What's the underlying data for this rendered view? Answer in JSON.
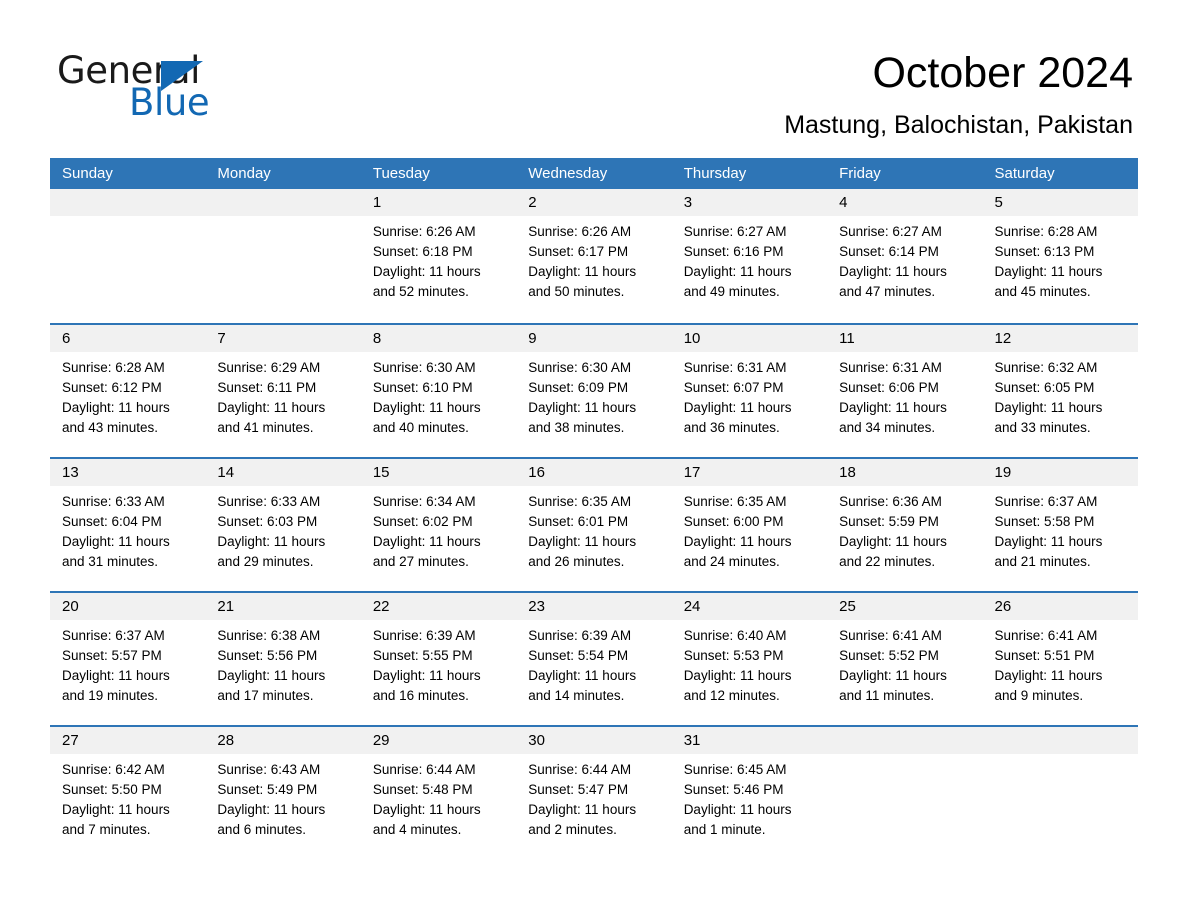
{
  "brand": {
    "word_one": "General",
    "word_two": "Blue",
    "triangle_icon": "triangle-icon",
    "accent_color": "#1268b3"
  },
  "header": {
    "title": "October 2024",
    "subtitle": "Mastung, Balochistan, Pakistan"
  },
  "theme": {
    "header_blue": "#2e75b6",
    "date_band_gray": "#f1f1f1",
    "text_black": "#000000"
  },
  "calendar": {
    "weekdays": [
      "Sunday",
      "Monday",
      "Tuesday",
      "Wednesday",
      "Thursday",
      "Friday",
      "Saturday"
    ],
    "weeks": [
      [
        {
          "day": "",
          "sunrise": "",
          "sunset": "",
          "daylight": "",
          "empty": true
        },
        {
          "day": "",
          "sunrise": "",
          "sunset": "",
          "daylight": "",
          "empty": true
        },
        {
          "day": "1",
          "sunrise": "Sunrise: 6:26 AM",
          "sunset": "Sunset: 6:18 PM",
          "daylight": "Daylight: 11 hours and 52 minutes."
        },
        {
          "day": "2",
          "sunrise": "Sunrise: 6:26 AM",
          "sunset": "Sunset: 6:17 PM",
          "daylight": "Daylight: 11 hours and 50 minutes."
        },
        {
          "day": "3",
          "sunrise": "Sunrise: 6:27 AM",
          "sunset": "Sunset: 6:16 PM",
          "daylight": "Daylight: 11 hours and 49 minutes."
        },
        {
          "day": "4",
          "sunrise": "Sunrise: 6:27 AM",
          "sunset": "Sunset: 6:14 PM",
          "daylight": "Daylight: 11 hours and 47 minutes."
        },
        {
          "day": "5",
          "sunrise": "Sunrise: 6:28 AM",
          "sunset": "Sunset: 6:13 PM",
          "daylight": "Daylight: 11 hours and 45 minutes."
        }
      ],
      [
        {
          "day": "6",
          "sunrise": "Sunrise: 6:28 AM",
          "sunset": "Sunset: 6:12 PM",
          "daylight": "Daylight: 11 hours and 43 minutes."
        },
        {
          "day": "7",
          "sunrise": "Sunrise: 6:29 AM",
          "sunset": "Sunset: 6:11 PM",
          "daylight": "Daylight: 11 hours and 41 minutes."
        },
        {
          "day": "8",
          "sunrise": "Sunrise: 6:30 AM",
          "sunset": "Sunset: 6:10 PM",
          "daylight": "Daylight: 11 hours and 40 minutes."
        },
        {
          "day": "9",
          "sunrise": "Sunrise: 6:30 AM",
          "sunset": "Sunset: 6:09 PM",
          "daylight": "Daylight: 11 hours and 38 minutes."
        },
        {
          "day": "10",
          "sunrise": "Sunrise: 6:31 AM",
          "sunset": "Sunset: 6:07 PM",
          "daylight": "Daylight: 11 hours and 36 minutes."
        },
        {
          "day": "11",
          "sunrise": "Sunrise: 6:31 AM",
          "sunset": "Sunset: 6:06 PM",
          "daylight": "Daylight: 11 hours and 34 minutes."
        },
        {
          "day": "12",
          "sunrise": "Sunrise: 6:32 AM",
          "sunset": "Sunset: 6:05 PM",
          "daylight": "Daylight: 11 hours and 33 minutes."
        }
      ],
      [
        {
          "day": "13",
          "sunrise": "Sunrise: 6:33 AM",
          "sunset": "Sunset: 6:04 PM",
          "daylight": "Daylight: 11 hours and 31 minutes."
        },
        {
          "day": "14",
          "sunrise": "Sunrise: 6:33 AM",
          "sunset": "Sunset: 6:03 PM",
          "daylight": "Daylight: 11 hours and 29 minutes."
        },
        {
          "day": "15",
          "sunrise": "Sunrise: 6:34 AM",
          "sunset": "Sunset: 6:02 PM",
          "daylight": "Daylight: 11 hours and 27 minutes."
        },
        {
          "day": "16",
          "sunrise": "Sunrise: 6:35 AM",
          "sunset": "Sunset: 6:01 PM",
          "daylight": "Daylight: 11 hours and 26 minutes."
        },
        {
          "day": "17",
          "sunrise": "Sunrise: 6:35 AM",
          "sunset": "Sunset: 6:00 PM",
          "daylight": "Daylight: 11 hours and 24 minutes."
        },
        {
          "day": "18",
          "sunrise": "Sunrise: 6:36 AM",
          "sunset": "Sunset: 5:59 PM",
          "daylight": "Daylight: 11 hours and 22 minutes."
        },
        {
          "day": "19",
          "sunrise": "Sunrise: 6:37 AM",
          "sunset": "Sunset: 5:58 PM",
          "daylight": "Daylight: 11 hours and 21 minutes."
        }
      ],
      [
        {
          "day": "20",
          "sunrise": "Sunrise: 6:37 AM",
          "sunset": "Sunset: 5:57 PM",
          "daylight": "Daylight: 11 hours and 19 minutes."
        },
        {
          "day": "21",
          "sunrise": "Sunrise: 6:38 AM",
          "sunset": "Sunset: 5:56 PM",
          "daylight": "Daylight: 11 hours and 17 minutes."
        },
        {
          "day": "22",
          "sunrise": "Sunrise: 6:39 AM",
          "sunset": "Sunset: 5:55 PM",
          "daylight": "Daylight: 11 hours and 16 minutes."
        },
        {
          "day": "23",
          "sunrise": "Sunrise: 6:39 AM",
          "sunset": "Sunset: 5:54 PM",
          "daylight": "Daylight: 11 hours and 14 minutes."
        },
        {
          "day": "24",
          "sunrise": "Sunrise: 6:40 AM",
          "sunset": "Sunset: 5:53 PM",
          "daylight": "Daylight: 11 hours and 12 minutes."
        },
        {
          "day": "25",
          "sunrise": "Sunrise: 6:41 AM",
          "sunset": "Sunset: 5:52 PM",
          "daylight": "Daylight: 11 hours and 11 minutes."
        },
        {
          "day": "26",
          "sunrise": "Sunrise: 6:41 AM",
          "sunset": "Sunset: 5:51 PM",
          "daylight": "Daylight: 11 hours and 9 minutes."
        }
      ],
      [
        {
          "day": "27",
          "sunrise": "Sunrise: 6:42 AM",
          "sunset": "Sunset: 5:50 PM",
          "daylight": "Daylight: 11 hours and 7 minutes."
        },
        {
          "day": "28",
          "sunrise": "Sunrise: 6:43 AM",
          "sunset": "Sunset: 5:49 PM",
          "daylight": "Daylight: 11 hours and 6 minutes."
        },
        {
          "day": "29",
          "sunrise": "Sunrise: 6:44 AM",
          "sunset": "Sunset: 5:48 PM",
          "daylight": "Daylight: 11 hours and 4 minutes."
        },
        {
          "day": "30",
          "sunrise": "Sunrise: 6:44 AM",
          "sunset": "Sunset: 5:47 PM",
          "daylight": "Daylight: 11 hours and 2 minutes."
        },
        {
          "day": "31",
          "sunrise": "Sunrise: 6:45 AM",
          "sunset": "Sunset: 5:46 PM",
          "daylight": "Daylight: 11 hours and 1 minute."
        },
        {
          "day": "",
          "sunrise": "",
          "sunset": "",
          "daylight": "",
          "empty": true
        },
        {
          "day": "",
          "sunrise": "",
          "sunset": "",
          "daylight": "",
          "empty": true
        }
      ]
    ]
  }
}
